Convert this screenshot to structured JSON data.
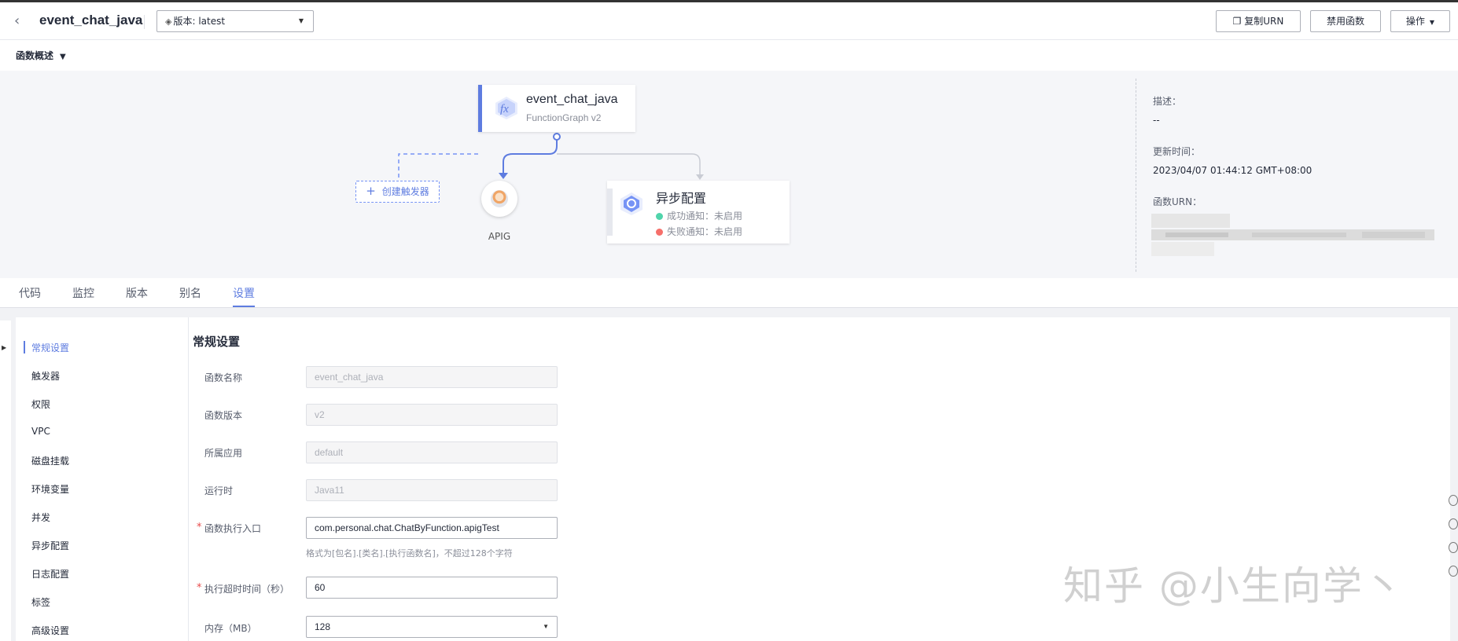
{
  "header": {
    "title": "event_chat_java",
    "version_select": "版本: latest",
    "copy_urn": "复制URN",
    "disable_function": "禁用函数",
    "operations": "操作"
  },
  "overview": {
    "label": "函数概述"
  },
  "diagram": {
    "function_name": "event_chat_java",
    "function_sub": "FunctionGraph v2",
    "create_trigger": "创建触发器",
    "apig_label": "APIG",
    "async_title": "异步配置",
    "success_notify": "成功通知：未启用",
    "failure_notify": "失败通知：未启用",
    "colors": {
      "accent": "#5e7ce0",
      "success": "#50d4ab",
      "failure": "#f66f6a"
    }
  },
  "side_info": {
    "desc_key": "描述：",
    "desc_val": "--",
    "updated_key": "更新时间：",
    "updated_val": "2023/04/07 01:44:12 GMT+08:00",
    "urn_key": "函数URN："
  },
  "tabs": [
    "代码",
    "监控",
    "版本",
    "别名",
    "设置"
  ],
  "active_tab": "设置",
  "submenu": [
    "常规设置",
    "触发器",
    "权限",
    "VPC",
    "磁盘挂载",
    "环境变量",
    "并发",
    "异步配置",
    "日志配置",
    "标签",
    "高级设置"
  ],
  "form": {
    "section_title": "常规设置",
    "function_name_label": "函数名称",
    "function_name_value": "event_chat_java",
    "function_version_label": "函数版本",
    "function_version_value": "v2",
    "app_label": "所属应用",
    "app_value": "default",
    "runtime_label": "运行时",
    "runtime_value": "Java11",
    "handler_label": "函数执行入口",
    "handler_value": "com.personal.chat.ChatByFunction.apigTest",
    "handler_hint": "格式为[包名].[类名].[执行函数名]，不超过128个字符",
    "timeout_label": "执行超时时间（秒）",
    "timeout_value": "60",
    "memory_label": "内存（MB）",
    "memory_value": "128"
  },
  "watermark": "知乎 @小生向学丶"
}
